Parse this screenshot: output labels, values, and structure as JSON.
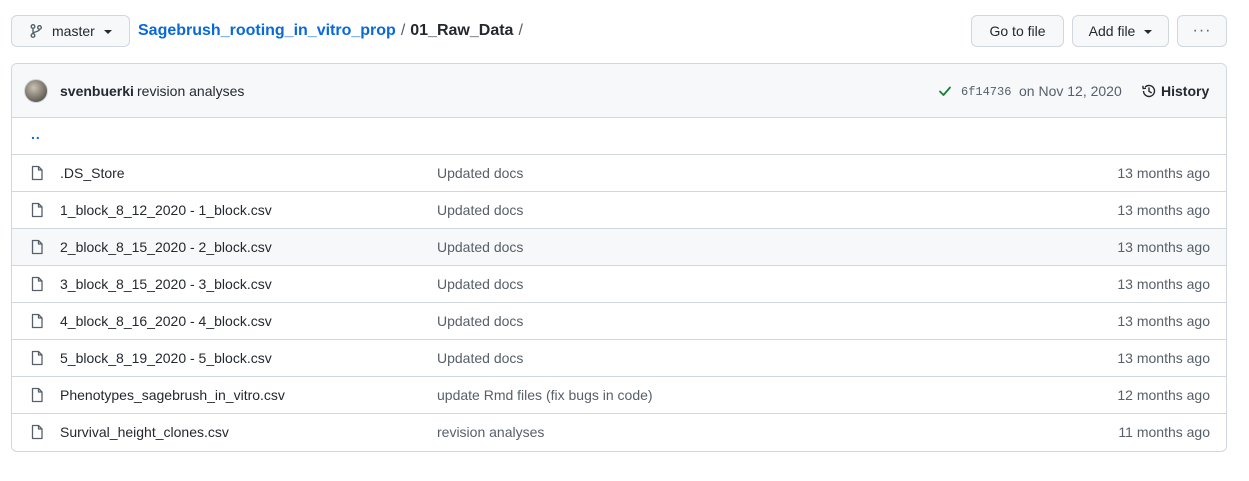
{
  "branch": {
    "name": "master"
  },
  "breadcrumb": {
    "repo": "Sagebrush_rooting_in_vitro_prop",
    "sep1": "/",
    "dir": "01_Raw_Data",
    "sep2": "/"
  },
  "actions": {
    "go_to_file": "Go to file",
    "add_file": "Add file",
    "more": "···"
  },
  "latest_commit": {
    "author": "svenbuerki",
    "message": "revision analyses",
    "sha": "6f14736",
    "date": "on Nov 12, 2020",
    "history_label": "History",
    "status": "success"
  },
  "parent_link": "..",
  "files": [
    {
      "name": ".DS_Store",
      "message": "Updated docs",
      "age": "13 months ago"
    },
    {
      "name": "1_block_8_12_2020 - 1_block.csv",
      "message": "Updated docs",
      "age": "13 months ago"
    },
    {
      "name": "2_block_8_15_2020 - 2_block.csv",
      "message": "Updated docs",
      "age": "13 months ago"
    },
    {
      "name": "3_block_8_15_2020 - 3_block.csv",
      "message": "Updated docs",
      "age": "13 months ago"
    },
    {
      "name": "4_block_8_16_2020 - 4_block.csv",
      "message": "Updated docs",
      "age": "13 months ago"
    },
    {
      "name": "5_block_8_19_2020 - 5_block.csv",
      "message": "Updated docs",
      "age": "13 months ago"
    },
    {
      "name": "Phenotypes_sagebrush_in_vitro.csv",
      "message": "update Rmd files (fix bugs in code)",
      "age": "12 months ago"
    },
    {
      "name": "Survival_height_clones.csv",
      "message": "revision analyses",
      "age": "11 months ago"
    }
  ],
  "colors": {
    "link": "#0969da",
    "success": "#1a7f37",
    "muted": "#57606a",
    "border": "#d0d7de"
  },
  "icons": {
    "branch": "git-branch-icon",
    "file": "file-icon",
    "history": "history-icon",
    "check": "check-icon"
  }
}
